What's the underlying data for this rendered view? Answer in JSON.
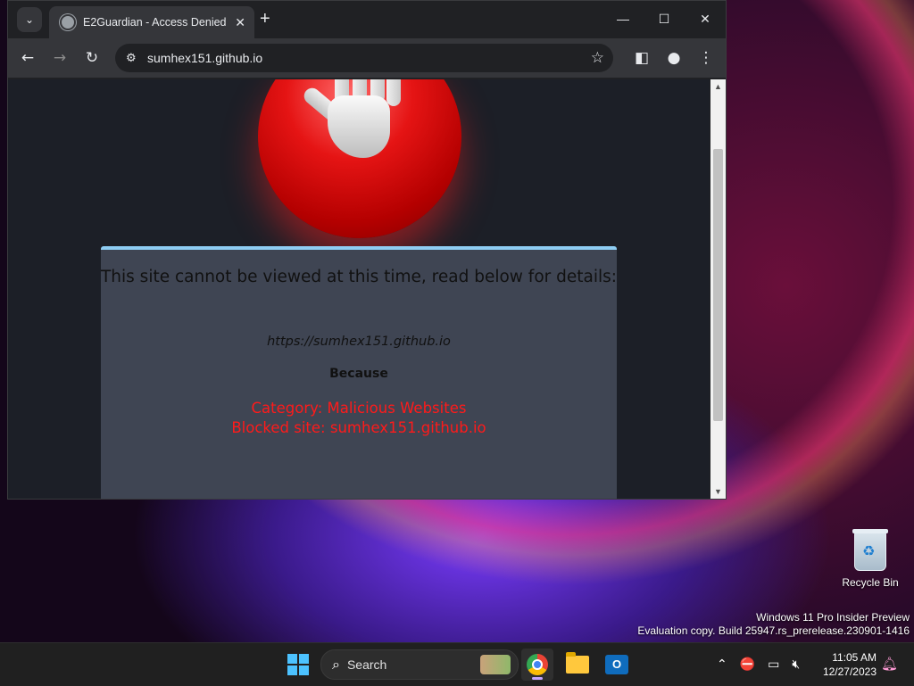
{
  "desktop": {
    "recycle_bin_label": "Recycle Bin",
    "watermark_line1": "Windows 11 Pro Insider Preview",
    "watermark_line2": "Evaluation copy. Build 25947.rs_prerelease.230901-1416"
  },
  "browser": {
    "tab_title": "E2Guardian - Access Denied",
    "address": "sumhex151.github.io",
    "icons": {
      "tab_search": "chevron-down-icon",
      "close_tab": "close-icon",
      "new_tab": "plus-icon",
      "back": "arrow-left-icon",
      "forward": "arrow-right-icon",
      "reload": "reload-icon",
      "site_info": "tune-icon",
      "bookmark": "star-icon",
      "side_panel": "side-panel-icon",
      "profile": "profile-icon",
      "menu": "kebab-menu-icon"
    }
  },
  "page": {
    "heading": "This site cannot be viewed at this time, read below for details:",
    "blocked_url": "https://sumhex151.github.io",
    "because": "Because",
    "category": "Category: Malicious Websites",
    "blocked_site": "Blocked site: sumhex151.github.io",
    "colors": {
      "panel_bg": "#3f4553",
      "panel_top_border": "#8ecdf3",
      "reason_text": "#ff1a1a"
    }
  },
  "taskbar": {
    "search_placeholder": "Search",
    "apps": [
      "Start",
      "Chrome",
      "File Explorer",
      "Outlook"
    ],
    "time": "11:05 AM",
    "date": "12/27/2023"
  }
}
